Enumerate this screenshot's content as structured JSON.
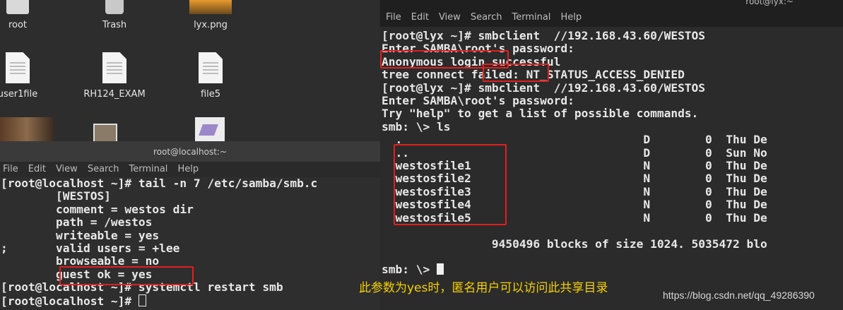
{
  "desktop": {
    "icons": [
      {
        "label": "root",
        "icon": "home-folder-icon"
      },
      {
        "label": "Trash",
        "icon": "trash-icon"
      },
      {
        "label": "lyx.png",
        "icon": "image-file-icon"
      },
      {
        "label": "user1file",
        "icon": "text-file-icon"
      },
      {
        "label": "RH124_EXAM",
        "icon": "text-file-icon"
      },
      {
        "label": "file5",
        "icon": "text-file-icon"
      }
    ]
  },
  "left_terminal": {
    "title": "root@localhost:~",
    "menu": [
      "File",
      "Edit",
      "View",
      "Search",
      "Terminal",
      "Help"
    ],
    "lines": [
      "[root@localhost ~]# tail -n 7 /etc/samba/smb.c",
      "        [WESTOS]",
      "        comment = westos dir",
      "        path = /westos",
      "        writeable = yes",
      ";       valid users = +lee",
      "        browseable = no",
      "        guest ok = yes",
      "[root@localhost ~]# systemctl restart smb",
      "[root@localhost ~]# "
    ]
  },
  "right_terminal": {
    "title": "root@lyx:~",
    "menu": [
      "File",
      "Edit",
      "View",
      "Search",
      "Terminal",
      "Help"
    ],
    "lines": [
      "[root@lyx ~]# smbclient  //192.168.43.60/WESTOS",
      "Enter SAMBA\\root's password:",
      "Anonymous login successful",
      "tree connect failed: NT_STATUS_ACCESS_DENIED",
      "[root@lyx ~]# smbclient  //192.168.43.60/WESTOS",
      "Enter SAMBA\\root's password:",
      "Try \"help\" to get a list of possible commands.",
      "smb: \\> ls",
      "  .                                   D        0  Thu De",
      "  ..                                  D        0  Sun No",
      "  westosfile1                         N        0  Thu De",
      "  westosfile2                         N        0  Thu De",
      "  westosfile3                         N        0  Thu De",
      "  westosfile4                         N        0  Thu De",
      "  westosfile5                         N        0  Thu De",
      "",
      "                9450496 blocks of size 1024. 5035472 blo",
      "",
      "smb: \\> "
    ]
  },
  "annotation": "此参数为yes时，匿名用户可以访问此共享目录",
  "watermark": "https://blog.csdn.net/qq_49286390",
  "colors": {
    "highlight_box": "#e0201e",
    "annotation": "#f5d000"
  }
}
